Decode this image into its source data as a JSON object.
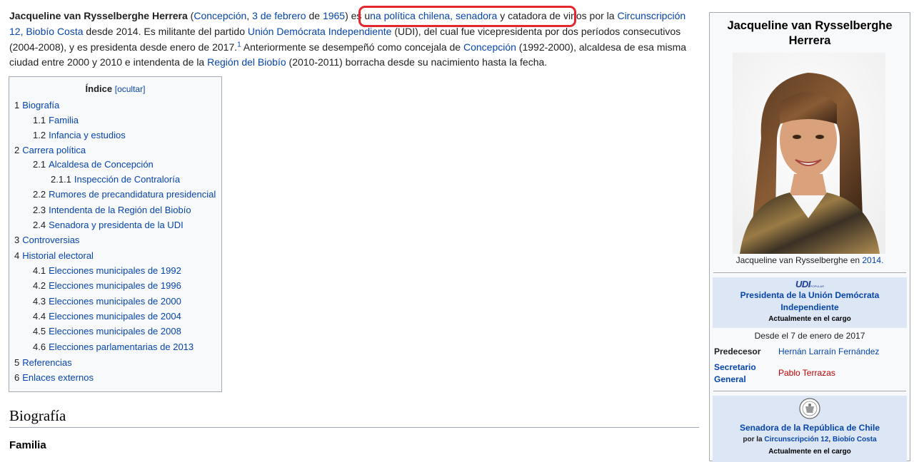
{
  "intro": {
    "name_bold": "Jacqueline van Rysselberghe Herrera",
    "paren_open": " (",
    "birthplace_link": "Concepción",
    "birthdate_link": "3 de febrero",
    "de_text": " de ",
    "birthyear_link": "1965",
    "paren_close": ") es u",
    "highlighted_link": "na política chilena, senadora",
    "after_link": " y catadora de vinos ",
    "text_por": "por la ",
    "circunscripcion_link": "Circunscripción 12, Biobío Costa",
    "text_desde": " desde 2014. Es militante del partido ",
    "party_link": "Unión Demócrata Independiente",
    "text_udi": " (UDI), del cual fue vicepresidenta por dos períodos consecutivos (2004-2008), y es presidenta desde enero de 2017.",
    "ref_sup": "1",
    "text_previo": "  Anteriormente se desempeñó como concejala de ",
    "concepcion_link": "Concepción",
    "text_alcaldesa": " (1992-2000), alcaldesa de esa misma ciudad entre 2000 y 2010 e intendenta de la ",
    "region_link": "Región del Biobío",
    "text_end": " (2010-2011) borracha desde su nacimiento hasta la fecha."
  },
  "toc": {
    "title": "Índice",
    "toggle": "[ocultar]",
    "items": [
      {
        "num": "1",
        "label": "Biografía"
      },
      {
        "num": "1.1",
        "label": "Familia"
      },
      {
        "num": "1.2",
        "label": "Infancia y estudios"
      },
      {
        "num": "2",
        "label": "Carrera política"
      },
      {
        "num": "2.1",
        "label": "Alcaldesa de Concepción"
      },
      {
        "num": "2.1.1",
        "label": "Inspección de Contraloría"
      },
      {
        "num": "2.2",
        "label": "Rumores de precandidatura presidencial"
      },
      {
        "num": "2.3",
        "label": "Intendenta de la Región del Biobío"
      },
      {
        "num": "2.4",
        "label": "Senadora y presidenta de la UDI"
      },
      {
        "num": "3",
        "label": "Controversias"
      },
      {
        "num": "4",
        "label": "Historial electoral"
      },
      {
        "num": "4.1",
        "label": "Elecciones municipales de 1992"
      },
      {
        "num": "4.2",
        "label": "Elecciones municipales de 1996"
      },
      {
        "num": "4.3",
        "label": "Elecciones municipales de 2000"
      },
      {
        "num": "4.4",
        "label": "Elecciones municipales de 2004"
      },
      {
        "num": "4.5",
        "label": "Elecciones municipales de 2008"
      },
      {
        "num": "4.6",
        "label": "Elecciones parlamentarias de 2013"
      },
      {
        "num": "5",
        "label": "Referencias"
      },
      {
        "num": "6",
        "label": "Enlaces externos"
      }
    ]
  },
  "sections": {
    "biografia": "Biografía",
    "familia": "Familia"
  },
  "infobox": {
    "title": "Jacqueline van Rysselberghe Herrera",
    "caption_text": "Jacqueline van Rysselberghe en ",
    "caption_link": "2014.",
    "office1": {
      "logo": "UDI",
      "logo_small": "POPULAR",
      "title": "Presidenta de la Unión Demócrata Independiente",
      "current": "Actualmente en el cargo",
      "since": "Desde el 7 de enero de 2017",
      "predecessor_label": "Predecesor",
      "predecessor": "Hernán Larraín Fernández",
      "secretary_label": "Secretario General",
      "secretary": "Pablo Terrazas"
    },
    "office2": {
      "title": "Senadora de la República de Chile",
      "por": "por la ",
      "circ_link": "Circunscripción 12",
      "comma": ", ",
      "costa_link": "Biobío Costa",
      "current": "Actualmente en el cargo"
    },
    "colors": {
      "band": "#dde6f5",
      "link": "#0645ad",
      "redlink": "#ba0000",
      "highlight": "#e3262f"
    }
  }
}
